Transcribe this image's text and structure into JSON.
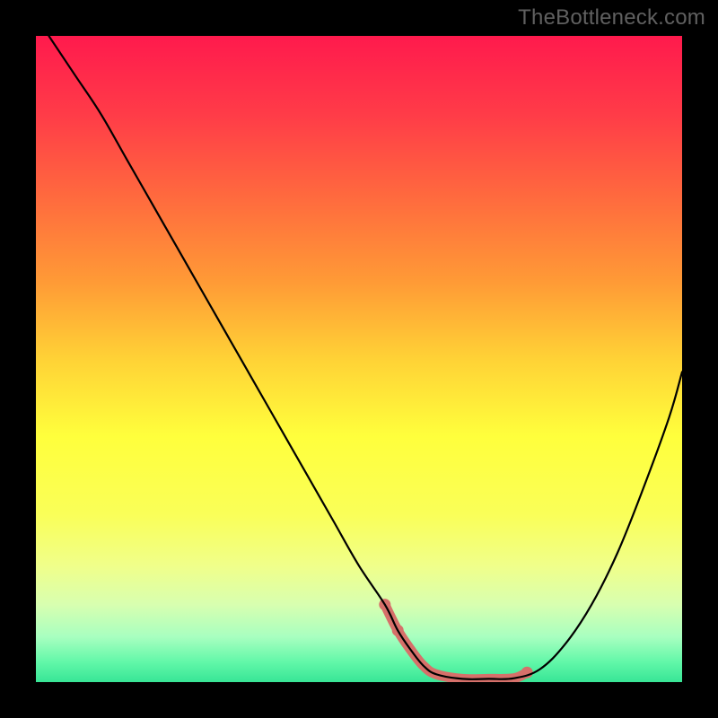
{
  "watermark": "TheBottleneck.com",
  "gradient": {
    "stops": [
      {
        "pct": 0,
        "color": "#ff1a4d"
      },
      {
        "pct": 12,
        "color": "#ff3b48"
      },
      {
        "pct": 25,
        "color": "#ff6a3e"
      },
      {
        "pct": 38,
        "color": "#ff9a36"
      },
      {
        "pct": 50,
        "color": "#ffd236"
      },
      {
        "pct": 62,
        "color": "#ffff3c"
      },
      {
        "pct": 74,
        "color": "#faff58"
      },
      {
        "pct": 82,
        "color": "#f0ff8a"
      },
      {
        "pct": 88,
        "color": "#d8ffb0"
      },
      {
        "pct": 93,
        "color": "#a8ffc0"
      },
      {
        "pct": 97,
        "color": "#60f7a8"
      },
      {
        "pct": 100,
        "color": "#38e596"
      }
    ]
  },
  "curve": {
    "color_main": "#000000",
    "width_main": 2.2,
    "color_mark": "#d6706a",
    "width_mark": 11,
    "marker_radius": 6.5
  },
  "chart_data": {
    "type": "line",
    "title": "",
    "xlabel": "",
    "ylabel": "",
    "xlim": [
      0,
      100
    ],
    "ylim": [
      0,
      100
    ],
    "series": [
      {
        "name": "bottleneck-curve",
        "x": [
          2,
          6,
          10,
          14,
          18,
          22,
          26,
          30,
          34,
          38,
          42,
          46,
          50,
          54,
          56,
          58,
          60,
          62,
          66,
          70,
          74,
          78,
          82,
          86,
          90,
          94,
          98,
          100
        ],
        "y": [
          100,
          94,
          88,
          81,
          74,
          67,
          60,
          53,
          46,
          39,
          32,
          25,
          18,
          12,
          8,
          5,
          2.5,
          1.2,
          0.5,
          0.5,
          0.6,
          2,
          6,
          12,
          20,
          30,
          41,
          48
        ]
      }
    ],
    "highlight": {
      "name": "optimal-range",
      "x": [
        54,
        56,
        58,
        60,
        62,
        66,
        70,
        74,
        76
      ],
      "y": [
        12,
        8,
        5,
        2.5,
        1.2,
        0.5,
        0.5,
        0.6,
        1.5
      ]
    },
    "highlight_markers": {
      "x": [
        54,
        56,
        76
      ],
      "y": [
        12,
        8,
        1.5
      ]
    }
  }
}
